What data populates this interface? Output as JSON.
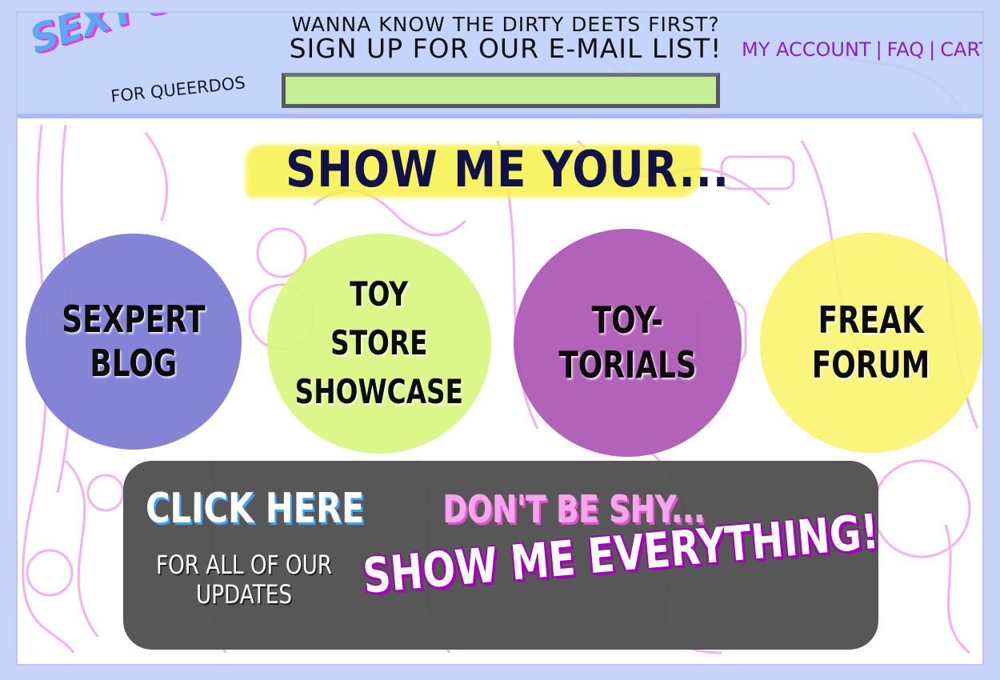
{
  "header": {
    "logo_main": "SEXY STUFF",
    "logo_sub": "FOR QUEERDOS",
    "signup_line1": "WANNA KNOW THE DIRTY DEETS FIRST?",
    "signup_line2": "SIGN UP FOR OUR E-MAIL LIST!",
    "email_value": "",
    "links": [
      "MY ACCOUNT",
      "FAQ",
      "CART"
    ],
    "separator": "|"
  },
  "main": {
    "headline": "SHOW ME YOUR...",
    "categories": [
      {
        "lines": [
          "SEXPERT",
          "BLOG"
        ],
        "color": "#7c7dd4"
      },
      {
        "lines": [
          "TOY",
          "STORE",
          "SHOWCASE"
        ],
        "color": "#d8f680"
      },
      {
        "lines": [
          "TOY-",
          "TORIALS"
        ],
        "color": "#ad56b4"
      },
      {
        "lines": [
          "FREAK",
          "FORUM"
        ],
        "color": "#f8f472"
      }
    ]
  },
  "updates": {
    "click_here": "CLICK HERE",
    "click_sub_line1": "FOR ALL OF OUR",
    "click_sub_line2": "UPDATES",
    "dont_be_shy": "DON'T BE SHY...",
    "show_everything": "SHOW ME EVERYTHING!"
  },
  "colors": {
    "page_bg": "#c9d4fb",
    "header_bg": "#bdcefb",
    "link_purple": "#8a1fc4",
    "headline_highlight": "#f7f24a",
    "panel_gray": "#505050",
    "accent_pink": "#e34fcf",
    "accent_purple": "#a300b8"
  }
}
